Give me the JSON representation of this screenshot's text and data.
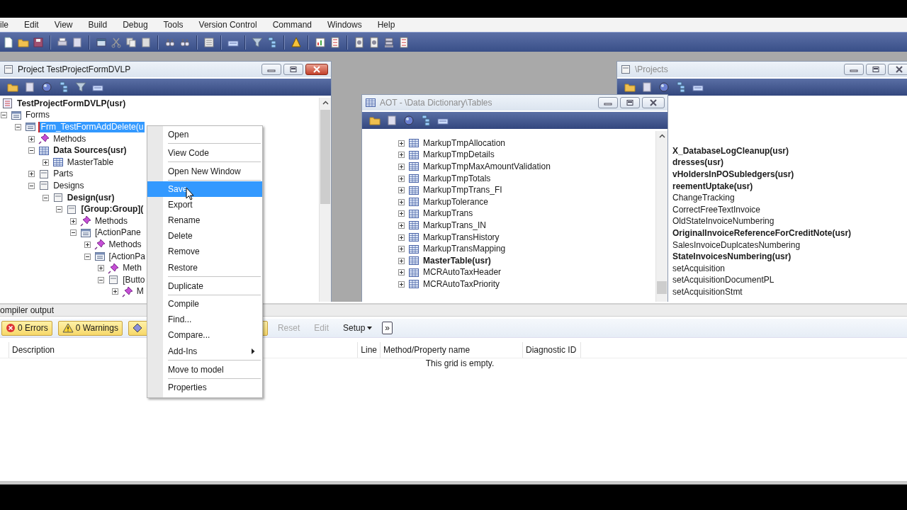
{
  "menu_bar": [
    "ile",
    "Edit",
    "View",
    "Build",
    "Debug",
    "Tools",
    "Version Control",
    "Command",
    "Windows",
    "Help"
  ],
  "project_window": {
    "title": "Project TestProjectFormDVLP",
    "active": true,
    "root": {
      "label": "TestProjectFormDVLP(usr)",
      "bold": true
    },
    "tree": [
      {
        "label": "Forms",
        "kind": "form",
        "bold": false,
        "selected": false,
        "expanded": true,
        "children": [
          {
            "label": "Frm_TestFormAddDelete(u",
            "kind": "form",
            "bold": false,
            "selected": true,
            "expanded": true,
            "children": [
              {
                "label": "Methods",
                "kind": "methods",
                "bold": false,
                "selected": false,
                "expanded": false
              },
              {
                "label": "Data Sources(usr)",
                "kind": "table",
                "bold": true,
                "selected": false,
                "expanded": true,
                "children": [
                  {
                    "label": "MasterTable",
                    "kind": "table",
                    "bold": false,
                    "selected": false,
                    "expanded": false
                  }
                ]
              },
              {
                "label": "Parts",
                "kind": "container",
                "bold": false,
                "selected": false,
                "expanded": false
              },
              {
                "label": "Designs",
                "kind": "container",
                "bold": false,
                "selected": false,
                "expanded": true,
                "children": [
                  {
                    "label": "Design(usr)",
                    "kind": "container",
                    "bold": true,
                    "selected": false,
                    "expanded": true,
                    "children": [
                      {
                        "label": "[Group:Group](",
                        "kind": "container",
                        "bold": true,
                        "selected": false,
                        "expanded": true,
                        "children": [
                          {
                            "label": "Methods",
                            "kind": "methods",
                            "bold": false,
                            "selected": false,
                            "expanded": false
                          },
                          {
                            "label": "[ActionPane",
                            "kind": "form",
                            "bold": false,
                            "selected": false,
                            "expanded": true,
                            "children": [
                              {
                                "label": "Methods",
                                "kind": "methods",
                                "bold": false,
                                "selected": false,
                                "expanded": false
                              },
                              {
                                "label": "[ActionPa",
                                "kind": "form",
                                "bold": false,
                                "selected": false,
                                "expanded": true,
                                "children": [
                                  {
                                    "label": "Meth",
                                    "kind": "methods",
                                    "bold": false,
                                    "selected": false,
                                    "expanded": false
                                  },
                                  {
                                    "label": "[Butto",
                                    "kind": "container",
                                    "bold": false,
                                    "selected": false,
                                    "expanded": true,
                                    "children": [
                                      {
                                        "label": "M",
                                        "kind": "methods",
                                        "bold": false,
                                        "selected": false,
                                        "expanded": false
                                      }
                                    ]
                                  }
                                ]
                              }
                            ]
                          }
                        ]
                      }
                    ]
                  }
                ]
              }
            ]
          }
        ]
      }
    ]
  },
  "aot_window": {
    "title": "AOT - \\Data Dictionary\\Tables",
    "active": false,
    "tables": [
      {
        "label": "MarkupTmpAllocation",
        "bold": false
      },
      {
        "label": "MarkupTmpDetails",
        "bold": false
      },
      {
        "label": "MarkupTmpMaxAmountValidation",
        "bold": false
      },
      {
        "label": "MarkupTmpTotals",
        "bold": false
      },
      {
        "label": "MarkupTmpTrans_FI",
        "bold": false
      },
      {
        "label": "MarkupTolerance",
        "bold": false
      },
      {
        "label": "MarkupTrans",
        "bold": false
      },
      {
        "label": "MarkupTrans_IN",
        "bold": false
      },
      {
        "label": "MarkupTransHistory",
        "bold": false
      },
      {
        "label": "MarkupTransMapping",
        "bold": false
      },
      {
        "label": "MasterTable(usr)",
        "bold": true
      },
      {
        "label": "MCRAutoTaxHeader",
        "bold": false
      },
      {
        "label": "MCRAutoTaxPriority",
        "bold": false
      }
    ]
  },
  "projects_window": {
    "title": "\\Projects",
    "active": false,
    "items": [
      {
        "label": "X_DatabaseLogCleanup(usr)",
        "bold": true
      },
      {
        "label": "dresses(usr)",
        "bold": true
      },
      {
        "label": "vHoldersInPOSubledgers(usr)",
        "bold": true
      },
      {
        "label": "reementUptake(usr)",
        "bold": true
      },
      {
        "label": "ChangeTracking",
        "bold": false
      },
      {
        "label": "CorrectFreeTextInvoice",
        "bold": false
      },
      {
        "label": "OldStateInvoiceNumbering",
        "bold": false
      },
      {
        "label": "OriginalInvoiceReferenceForCreditNote(usr)",
        "bold": true
      },
      {
        "label": "SalesInvoiceDuplcatesNumbering",
        "bold": false
      },
      {
        "label": "StateInvoicesNumbering(usr)",
        "bold": true
      },
      {
        "label": "setAcquisition",
        "bold": false
      },
      {
        "label": "setAcquisitionDocumentPL",
        "bold": false
      },
      {
        "label": "setAcquisitionStmt",
        "bold": false
      }
    ]
  },
  "context_menu": {
    "items": [
      {
        "label": "Open",
        "selected": false,
        "separator_after": true,
        "submenu": false
      },
      {
        "label": "View Code",
        "selected": false,
        "separator_after": true,
        "submenu": false
      },
      {
        "label": "Open New Window",
        "selected": false,
        "separator_after": true,
        "submenu": false
      },
      {
        "label": "Save",
        "selected": true,
        "separator_after": false,
        "submenu": false
      },
      {
        "label": "Export",
        "selected": false,
        "separator_after": false,
        "submenu": false
      },
      {
        "label": "Rename",
        "selected": false,
        "separator_after": false,
        "submenu": false
      },
      {
        "label": "Delete",
        "selected": false,
        "separator_after": false,
        "submenu": false
      },
      {
        "label": "Remove",
        "selected": false,
        "separator_after": false,
        "submenu": false
      },
      {
        "label": "Restore",
        "selected": false,
        "separator_after": true,
        "submenu": false
      },
      {
        "label": "Duplicate",
        "selected": false,
        "separator_after": true,
        "submenu": false
      },
      {
        "label": "Compile",
        "selected": false,
        "separator_after": false,
        "submenu": false
      },
      {
        "label": "Find...",
        "selected": false,
        "separator_after": false,
        "submenu": false
      },
      {
        "label": "Compare...",
        "selected": false,
        "separator_after": false,
        "submenu": false
      },
      {
        "label": "Add-Ins",
        "selected": false,
        "separator_after": true,
        "submenu": true
      },
      {
        "label": "Move to model",
        "selected": false,
        "separator_after": true,
        "submenu": false
      },
      {
        "label": "Properties",
        "selected": false,
        "separator_after": false,
        "submenu": false
      }
    ]
  },
  "compiler_output": {
    "title": "ompiler output",
    "buttons": [
      {
        "kind": "errors",
        "label": "0 Errors",
        "disabled": false
      },
      {
        "kind": "warnings",
        "label": "0 Warnings",
        "disabled": false
      },
      {
        "kind": "info"
      },
      {
        "kind": "plain",
        "label": "Reset",
        "disabled": true
      },
      {
        "kind": "plain",
        "label": "Edit",
        "disabled": true
      },
      {
        "kind": "dropdown",
        "label": "Setup",
        "disabled": false
      },
      {
        "kind": "overflow",
        "label": "»",
        "disabled": false
      }
    ],
    "columns": [
      "Description",
      "Line",
      "Method/Property name",
      "Diagnostic ID"
    ],
    "empty_message": "This grid is empty."
  }
}
